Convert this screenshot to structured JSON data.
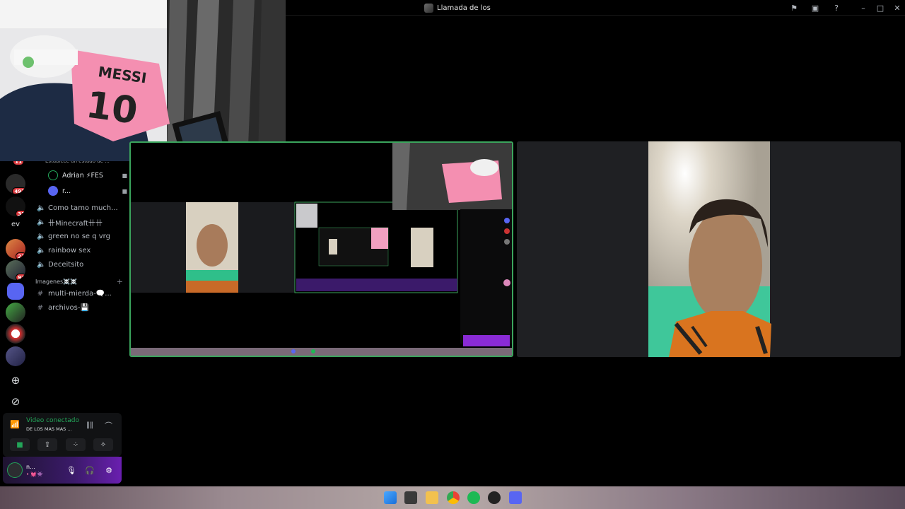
{
  "window": {
    "title": "Llamada de los"
  },
  "channels": {
    "status_hint": "Establece un estado de ...",
    "voice_users": [
      {
        "name": "Adrian ⚡FES"
      },
      {
        "name": "r..."
      }
    ],
    "voice_channels": [
      "Como tamo much...",
      "卄Minecraft卄卄",
      "green no se q vrg",
      "rainbow sex",
      "Deceitsito"
    ],
    "category": "Imagenes☠️☠️",
    "text_channels": [
      "multi-mierda-🗨️...",
      "archivos-💾"
    ]
  },
  "rail": {
    "badges": [
      "11",
      "492",
      "31",
      "21",
      "97"
    ],
    "text_server": "ev"
  },
  "voice_panel": {
    "status": "Video conectado",
    "subtitle": "DE LOS MAS MAS ..."
  },
  "user_panel": {
    "name": "n...",
    "sub": "• 💓👾"
  },
  "colors": {
    "online": "#23a559",
    "accent": "#5865f2",
    "mention": "#da373c"
  }
}
